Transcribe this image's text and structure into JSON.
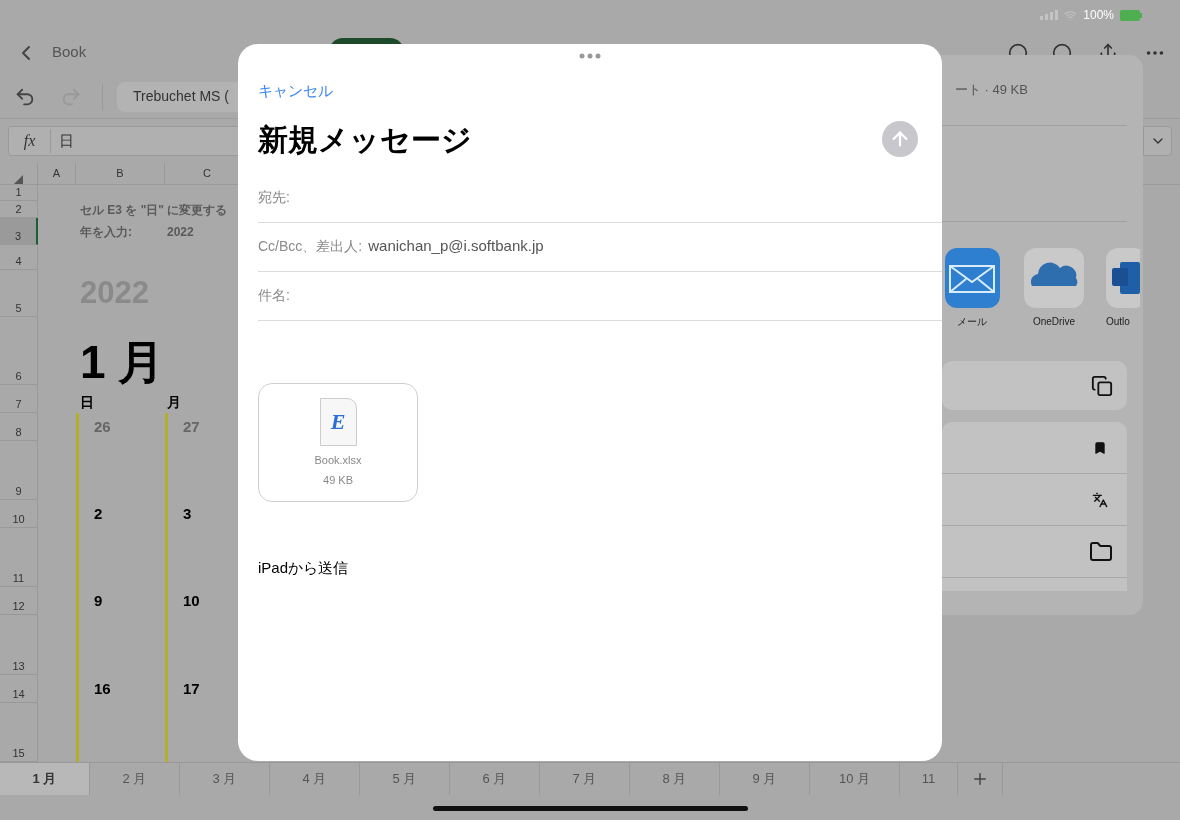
{
  "status_bar": {
    "battery": "100%"
  },
  "toolbar": {
    "back_title": "Book",
    "font": "Trebuchet MS ("
  },
  "formula_bar": {
    "fx_label": "fx",
    "value": "日"
  },
  "sheet": {
    "columns": [
      "A",
      "B",
      "C"
    ],
    "rows": [
      {
        "number": "1",
        "lined": false,
        "selected": false,
        "cells": []
      },
      {
        "number": "2",
        "lined": false,
        "selected": false,
        "cells": [
          {
            "kind": "note",
            "text": "セル E3 を \"日\" に変更する"
          }
        ]
      },
      {
        "number": "3",
        "lined": false,
        "selected": true,
        "cells": [
          {
            "kind": "note",
            "text": "年を入力:"
          },
          {
            "kind": "note",
            "text": "2022"
          }
        ]
      },
      {
        "number": "4",
        "lined": false,
        "selected": false,
        "cells": []
      },
      {
        "number": "5",
        "lined": false,
        "selected": false,
        "cells": [
          {
            "kind": "year",
            "text": "2022"
          }
        ]
      },
      {
        "number": "6",
        "lined": false,
        "selected": false,
        "cells": [
          {
            "kind": "month",
            "text": "1 月"
          }
        ]
      },
      {
        "number": "7",
        "lined": false,
        "selected": false,
        "cells": [
          {
            "kind": "weekday",
            "text": "日"
          },
          {
            "kind": "weekday",
            "text": "月"
          }
        ]
      },
      {
        "number": "8",
        "lined": true,
        "selected": false,
        "cells": [
          {
            "kind": "day_faded",
            "text": "26"
          },
          {
            "kind": "day_faded",
            "text": "27"
          }
        ]
      },
      {
        "number": "9",
        "lined": true,
        "selected": false,
        "cells": []
      },
      {
        "number": "10",
        "lined": true,
        "selected": false,
        "cells": [
          {
            "kind": "day",
            "text": "2"
          },
          {
            "kind": "day",
            "text": "3"
          }
        ]
      },
      {
        "number": "11",
        "lined": true,
        "selected": false,
        "cells": []
      },
      {
        "number": "12",
        "lined": true,
        "selected": false,
        "cells": [
          {
            "kind": "day",
            "text": "9"
          },
          {
            "kind": "day",
            "text": "10"
          }
        ]
      },
      {
        "number": "13",
        "lined": true,
        "selected": false,
        "cells": []
      },
      {
        "number": "14",
        "lined": true,
        "selected": false,
        "cells": [
          {
            "kind": "day",
            "text": "16"
          },
          {
            "kind": "day",
            "text": "17"
          }
        ]
      },
      {
        "number": "15",
        "lined": true,
        "selected": false,
        "cells": []
      }
    ]
  },
  "sheet_tabs": [
    {
      "label": "1 月",
      "selected": true
    },
    {
      "label": "2 月",
      "selected": false
    },
    {
      "label": "3 月",
      "selected": false
    },
    {
      "label": "4 月",
      "selected": false
    },
    {
      "label": "5 月",
      "selected": false
    },
    {
      "label": "6 月",
      "selected": false
    },
    {
      "label": "7 月",
      "selected": false
    },
    {
      "label": "8 月",
      "selected": false
    },
    {
      "label": "9 月",
      "selected": false
    },
    {
      "label": "10 月",
      "selected": false
    },
    {
      "label": "11",
      "selected": false
    }
  ],
  "share_sheet": {
    "file_info": "ート · 49 KB",
    "apps": [
      {
        "label": "メール",
        "kind": "mail"
      },
      {
        "label": "OneDrive",
        "kind": "onedrive"
      },
      {
        "label": "Outlo",
        "kind": "outlook"
      }
    ]
  },
  "compose": {
    "cancel": "キャンセル",
    "title": "新規メッセージ",
    "send_enabled": false,
    "fields": [
      {
        "label": "宛先:"
      },
      {
        "label": "Cc/Bcc、差出人:",
        "value": "wanichan_p@i.softbank.jp"
      },
      {
        "label": "件名:"
      }
    ],
    "attachment": {
      "icon_letter": "E",
      "name": "Book.xlsx",
      "size": "49 KB"
    },
    "signature": "iPadから送信"
  }
}
